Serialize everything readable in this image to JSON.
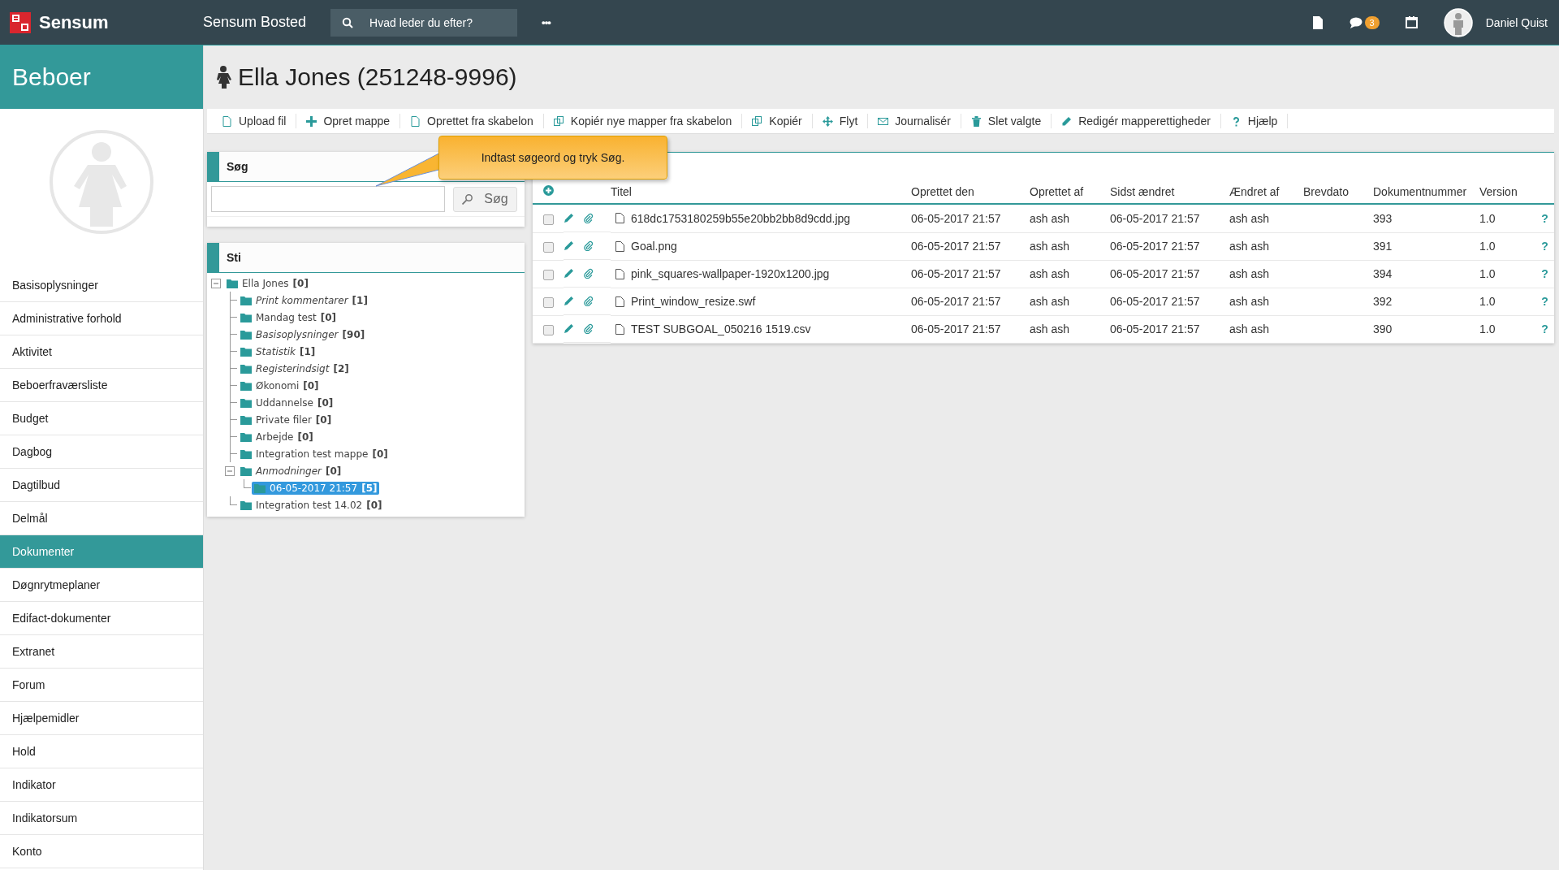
{
  "topbar": {
    "brand": "Sensum",
    "app_title": "Sensum Bosted",
    "search": {
      "placeholder": "Hvad leder du efter?"
    },
    "more": "•••",
    "messages_badge": "3",
    "user": "Daniel Quist"
  },
  "sidebar": {
    "title": "Beboer",
    "items": [
      {
        "label": "Basisoplysninger",
        "selected": false
      },
      {
        "label": "Administrative forhold",
        "selected": false
      },
      {
        "label": "Aktivitet",
        "selected": false
      },
      {
        "label": "Beboerfraværsliste",
        "selected": false
      },
      {
        "label": "Budget",
        "selected": false
      },
      {
        "label": "Dagbog",
        "selected": false
      },
      {
        "label": "Dagtilbud",
        "selected": false
      },
      {
        "label": "Delmål",
        "selected": false
      },
      {
        "label": "Dokumenter",
        "selected": true
      },
      {
        "label": "Døgnrytmeplaner",
        "selected": false
      },
      {
        "label": "Edifact-dokumenter",
        "selected": false
      },
      {
        "label": "Extranet",
        "selected": false
      },
      {
        "label": "Forum",
        "selected": false
      },
      {
        "label": "Hjælpemidler",
        "selected": false
      },
      {
        "label": "Hold",
        "selected": false
      },
      {
        "label": "Indikator",
        "selected": false
      },
      {
        "label": "Indikatorsum",
        "selected": false
      },
      {
        "label": "Konto",
        "selected": false
      }
    ]
  },
  "page_title": "Ella Jones (251248-9996)",
  "toolbar": [
    "Upload fil",
    "Opret mappe",
    "Oprettet fra skabelon",
    "Kopiér nye mapper fra skabelon",
    "Kopiér",
    "Flyt",
    "Journalisér",
    "Slet valgte",
    "Redigér mapperettigheder",
    "Hjælp"
  ],
  "search_panel": {
    "title": "Søg",
    "button": "Søg"
  },
  "tooltip": "Indtast søgeord og tryk Søg.",
  "tree_panel": {
    "title": "Sti",
    "tree": [
      {
        "label": "Ella Jones",
        "count": "[0]",
        "emphasized": false,
        "expanded": true,
        "selected": false,
        "children": [
          {
            "label": "Print kommentarer",
            "count": "[1]",
            "emphasized": true,
            "selected": false
          },
          {
            "label": "Mandag test",
            "count": "[0]",
            "emphasized": false,
            "selected": false
          },
          {
            "label": "Basisoplysninger",
            "count": "[90]",
            "emphasized": true,
            "selected": false
          },
          {
            "label": "Statistik",
            "count": "[1]",
            "emphasized": true,
            "selected": false
          },
          {
            "label": "Registerindsigt",
            "count": "[2]",
            "emphasized": true,
            "selected": false
          },
          {
            "label": "Økonomi",
            "count": "[0]",
            "emphasized": false,
            "selected": false
          },
          {
            "label": "Uddannelse",
            "count": "[0]",
            "emphasized": false,
            "selected": false
          },
          {
            "label": "Private filer",
            "count": "[0]",
            "emphasized": false,
            "selected": false
          },
          {
            "label": "Arbejde",
            "count": "[0]",
            "emphasized": false,
            "selected": false
          },
          {
            "label": "Integration test mappe",
            "count": "[0]",
            "emphasized": false,
            "selected": false
          },
          {
            "label": "Anmodninger",
            "count": "[0]",
            "emphasized": true,
            "expanded": true,
            "selected": false,
            "children": [
              {
                "label": "06-05-2017 21:57",
                "count": "[5]",
                "emphasized": false,
                "selected": true
              }
            ]
          },
          {
            "label": "Integration test 14.02",
            "count": "[0]",
            "emphasized": false,
            "selected": false
          }
        ]
      }
    ]
  },
  "table": {
    "columns": [
      "Titel",
      "Oprettet den",
      "Oprettet af",
      "Sidst ændret",
      "Ændret af",
      "Brevdato",
      "Dokumentnummer",
      "Version"
    ],
    "rows": [
      {
        "checked": false,
        "title": "618dc1753180259b55e20bb2bb8d9cdd.jpg",
        "created": "06-05-2017 21:57",
        "created_by": "ash ash",
        "changed": "06-05-2017 21:57",
        "changed_by": "ash ash",
        "number": "393",
        "version": "1.0",
        "help": "?"
      },
      {
        "checked": false,
        "title": "Goal.png",
        "created": "06-05-2017 21:57",
        "created_by": "ash ash",
        "changed": "06-05-2017 21:57",
        "changed_by": "ash ash",
        "number": "391",
        "version": "1.0",
        "help": "?"
      },
      {
        "checked": false,
        "title": "pink_squares-wallpaper-1920x1200.jpg",
        "created": "06-05-2017 21:57",
        "created_by": "ash ash",
        "changed": "06-05-2017 21:57",
        "changed_by": "ash ash",
        "number": "394",
        "version": "1.0",
        "help": "?"
      },
      {
        "checked": false,
        "title": "Print_window_resize.swf",
        "created": "06-05-2017 21:57",
        "created_by": "ash ash",
        "changed": "06-05-2017 21:57",
        "changed_by": "ash ash",
        "number": "392",
        "version": "1.0",
        "help": "?"
      },
      {
        "checked": false,
        "title": "TEST SUBGOAL_050216 1519.csv",
        "created": "06-05-2017 21:57",
        "created_by": "ash ash",
        "changed": "06-05-2017 21:57",
        "changed_by": "ash ash",
        "number": "390",
        "version": "1.0",
        "help": "?"
      }
    ]
  }
}
